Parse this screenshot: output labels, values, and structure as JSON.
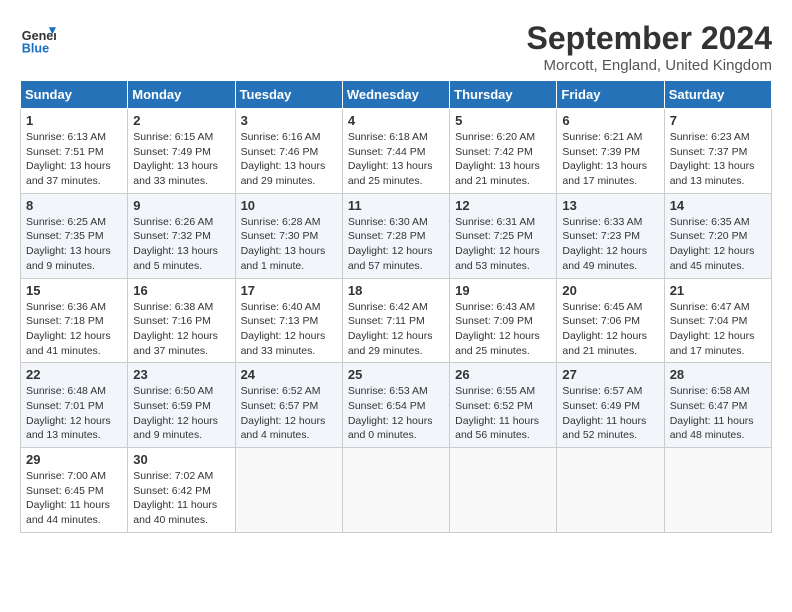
{
  "header": {
    "logo_line1": "General",
    "logo_line2": "Blue",
    "title": "September 2024",
    "location": "Morcott, England, United Kingdom"
  },
  "weekdays": [
    "Sunday",
    "Monday",
    "Tuesday",
    "Wednesday",
    "Thursday",
    "Friday",
    "Saturday"
  ],
  "weeks": [
    [
      {
        "day": "1",
        "sunrise": "6:13 AM",
        "sunset": "7:51 PM",
        "daylight": "13 hours and 37 minutes."
      },
      {
        "day": "2",
        "sunrise": "6:15 AM",
        "sunset": "7:49 PM",
        "daylight": "13 hours and 33 minutes."
      },
      {
        "day": "3",
        "sunrise": "6:16 AM",
        "sunset": "7:46 PM",
        "daylight": "13 hours and 29 minutes."
      },
      {
        "day": "4",
        "sunrise": "6:18 AM",
        "sunset": "7:44 PM",
        "daylight": "13 hours and 25 minutes."
      },
      {
        "day": "5",
        "sunrise": "6:20 AM",
        "sunset": "7:42 PM",
        "daylight": "13 hours and 21 minutes."
      },
      {
        "day": "6",
        "sunrise": "6:21 AM",
        "sunset": "7:39 PM",
        "daylight": "13 hours and 17 minutes."
      },
      {
        "day": "7",
        "sunrise": "6:23 AM",
        "sunset": "7:37 PM",
        "daylight": "13 hours and 13 minutes."
      }
    ],
    [
      {
        "day": "8",
        "sunrise": "6:25 AM",
        "sunset": "7:35 PM",
        "daylight": "13 hours and 9 minutes."
      },
      {
        "day": "9",
        "sunrise": "6:26 AM",
        "sunset": "7:32 PM",
        "daylight": "13 hours and 5 minutes."
      },
      {
        "day": "10",
        "sunrise": "6:28 AM",
        "sunset": "7:30 PM",
        "daylight": "13 hours and 1 minute."
      },
      {
        "day": "11",
        "sunrise": "6:30 AM",
        "sunset": "7:28 PM",
        "daylight": "12 hours and 57 minutes."
      },
      {
        "day": "12",
        "sunrise": "6:31 AM",
        "sunset": "7:25 PM",
        "daylight": "12 hours and 53 minutes."
      },
      {
        "day": "13",
        "sunrise": "6:33 AM",
        "sunset": "7:23 PM",
        "daylight": "12 hours and 49 minutes."
      },
      {
        "day": "14",
        "sunrise": "6:35 AM",
        "sunset": "7:20 PM",
        "daylight": "12 hours and 45 minutes."
      }
    ],
    [
      {
        "day": "15",
        "sunrise": "6:36 AM",
        "sunset": "7:18 PM",
        "daylight": "12 hours and 41 minutes."
      },
      {
        "day": "16",
        "sunrise": "6:38 AM",
        "sunset": "7:16 PM",
        "daylight": "12 hours and 37 minutes."
      },
      {
        "day": "17",
        "sunrise": "6:40 AM",
        "sunset": "7:13 PM",
        "daylight": "12 hours and 33 minutes."
      },
      {
        "day": "18",
        "sunrise": "6:42 AM",
        "sunset": "7:11 PM",
        "daylight": "12 hours and 29 minutes."
      },
      {
        "day": "19",
        "sunrise": "6:43 AM",
        "sunset": "7:09 PM",
        "daylight": "12 hours and 25 minutes."
      },
      {
        "day": "20",
        "sunrise": "6:45 AM",
        "sunset": "7:06 PM",
        "daylight": "12 hours and 21 minutes."
      },
      {
        "day": "21",
        "sunrise": "6:47 AM",
        "sunset": "7:04 PM",
        "daylight": "12 hours and 17 minutes."
      }
    ],
    [
      {
        "day": "22",
        "sunrise": "6:48 AM",
        "sunset": "7:01 PM",
        "daylight": "12 hours and 13 minutes."
      },
      {
        "day": "23",
        "sunrise": "6:50 AM",
        "sunset": "6:59 PM",
        "daylight": "12 hours and 9 minutes."
      },
      {
        "day": "24",
        "sunrise": "6:52 AM",
        "sunset": "6:57 PM",
        "daylight": "12 hours and 4 minutes."
      },
      {
        "day": "25",
        "sunrise": "6:53 AM",
        "sunset": "6:54 PM",
        "daylight": "12 hours and 0 minutes."
      },
      {
        "day": "26",
        "sunrise": "6:55 AM",
        "sunset": "6:52 PM",
        "daylight": "11 hours and 56 minutes."
      },
      {
        "day": "27",
        "sunrise": "6:57 AM",
        "sunset": "6:49 PM",
        "daylight": "11 hours and 52 minutes."
      },
      {
        "day": "28",
        "sunrise": "6:58 AM",
        "sunset": "6:47 PM",
        "daylight": "11 hours and 48 minutes."
      }
    ],
    [
      {
        "day": "29",
        "sunrise": "7:00 AM",
        "sunset": "6:45 PM",
        "daylight": "11 hours and 44 minutes."
      },
      {
        "day": "30",
        "sunrise": "7:02 AM",
        "sunset": "6:42 PM",
        "daylight": "11 hours and 40 minutes."
      },
      null,
      null,
      null,
      null,
      null
    ]
  ]
}
